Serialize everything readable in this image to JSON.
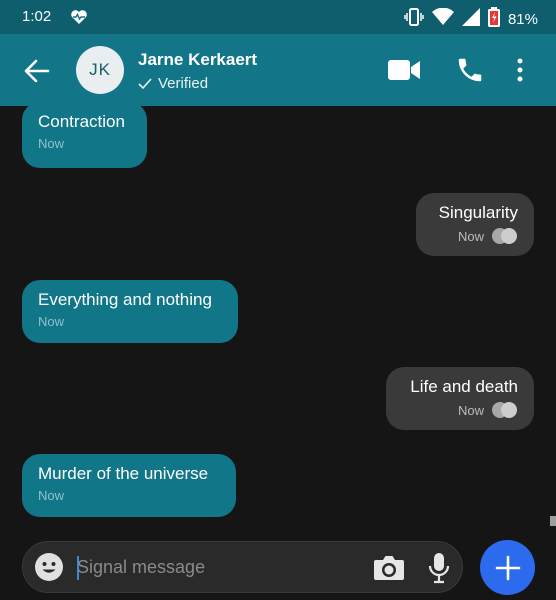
{
  "status_bar": {
    "time": "1:02",
    "battery": "81%"
  },
  "header": {
    "avatar_initials": "JK",
    "contact_name": "Jarne Kerkaert",
    "verified_label": "Verified"
  },
  "messages": [
    {
      "direction": "in",
      "text": "Contraction",
      "time": "Now"
    },
    {
      "direction": "out",
      "text": "Singularity",
      "time": "Now"
    },
    {
      "direction": "in",
      "text": "Everything and nothing",
      "time": "Now"
    },
    {
      "direction": "out",
      "text": "Life and death",
      "time": "Now"
    },
    {
      "direction": "in",
      "text": "Murder of the universe",
      "time": "Now"
    }
  ],
  "composer": {
    "placeholder": "Signal message"
  },
  "colors": {
    "header": "#127688",
    "status_bar": "#0f5e6e",
    "incoming_bubble": "#117688",
    "outgoing_bubble": "#3a3a3a",
    "send_button": "#2c6bed",
    "background": "#151515"
  },
  "icons": [
    "heart-pulse-icon",
    "vibrate-icon",
    "wifi-icon",
    "signal-icon",
    "battery-icon",
    "back-arrow-icon",
    "video-call-icon",
    "phone-icon",
    "more-vert-icon",
    "emoji-icon",
    "camera-icon",
    "mic-icon",
    "plus-icon",
    "check-icon",
    "delivered-checks-icon"
  ]
}
